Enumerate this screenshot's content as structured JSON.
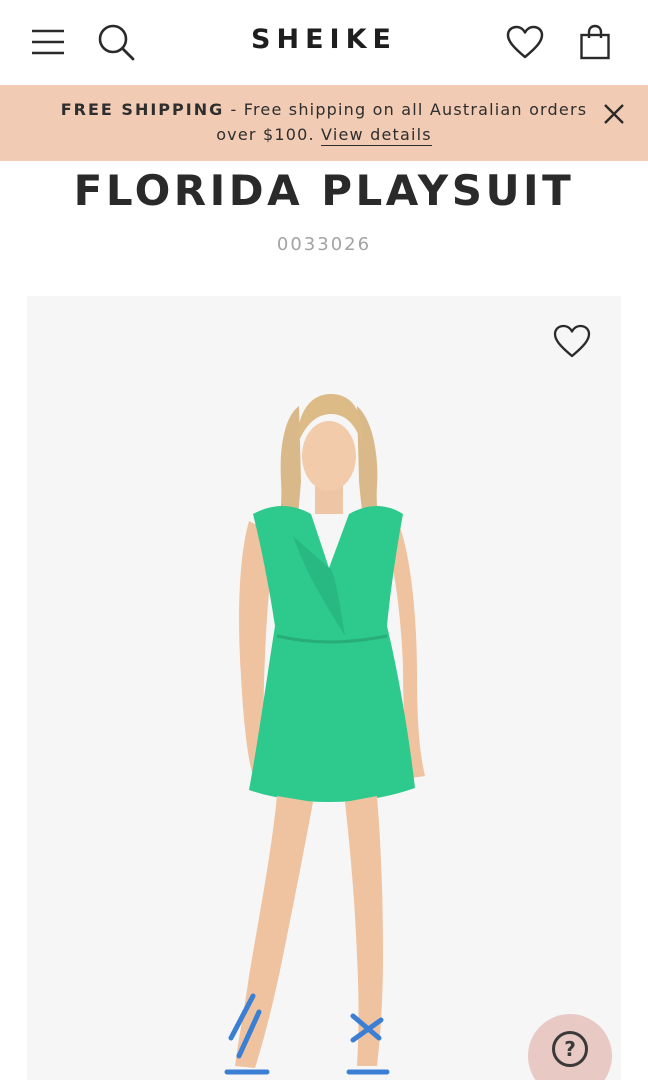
{
  "header": {
    "logo": "SHEIKE",
    "icons": {
      "menu": "hamburger-menu-icon",
      "search": "search-icon",
      "wishlist": "heart-icon",
      "bag": "shopping-bag-icon"
    }
  },
  "banner": {
    "strong": "FREE SHIPPING",
    "separator": " - ",
    "text": "Free shipping on all Australian orders over $100. ",
    "link": "View details",
    "close_icon": "close-icon",
    "background": "#f1cbb4"
  },
  "product": {
    "title": "FLORIDA PLAYSUIT",
    "sku": "0033026",
    "image_icon": "heart-icon",
    "dress_color": "#2ec98d",
    "shoe_color": "#3b7fd4"
  },
  "help": {
    "icon": "question-mark-icon",
    "symbol": "?"
  }
}
